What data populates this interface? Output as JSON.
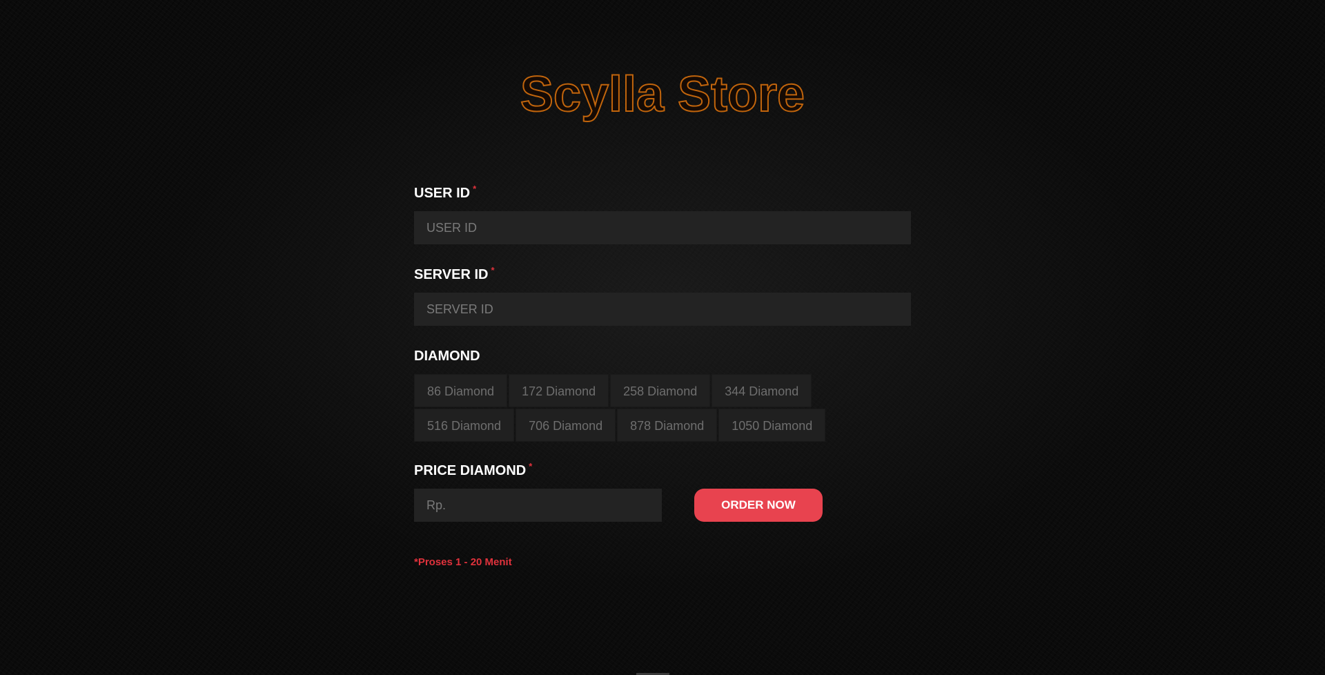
{
  "header": {
    "title": "Scylla Store"
  },
  "form": {
    "user_id": {
      "label": "USER ID",
      "required_mark": "*",
      "placeholder": "USER ID"
    },
    "server_id": {
      "label": "SERVER ID",
      "required_mark": "*",
      "placeholder": "SERVER ID"
    },
    "diamond": {
      "label": "DIAMOND",
      "options": [
        "86 Diamond",
        "172 Diamond",
        "258 Diamond",
        "344 Diamond",
        "516 Diamond",
        "706 Diamond",
        "878 Diamond",
        "1050 Diamond"
      ]
    },
    "price": {
      "label": "PRICE DIAMOND",
      "required_mark": "*",
      "placeholder": "Rp."
    },
    "order_button": "ORDER NOW",
    "note": "*Proses 1 - 20 Menit"
  },
  "colors": {
    "accent": "#e8434f",
    "title_outline": "#c2650c",
    "required": "#e0323c",
    "field_bg": "#232323"
  }
}
